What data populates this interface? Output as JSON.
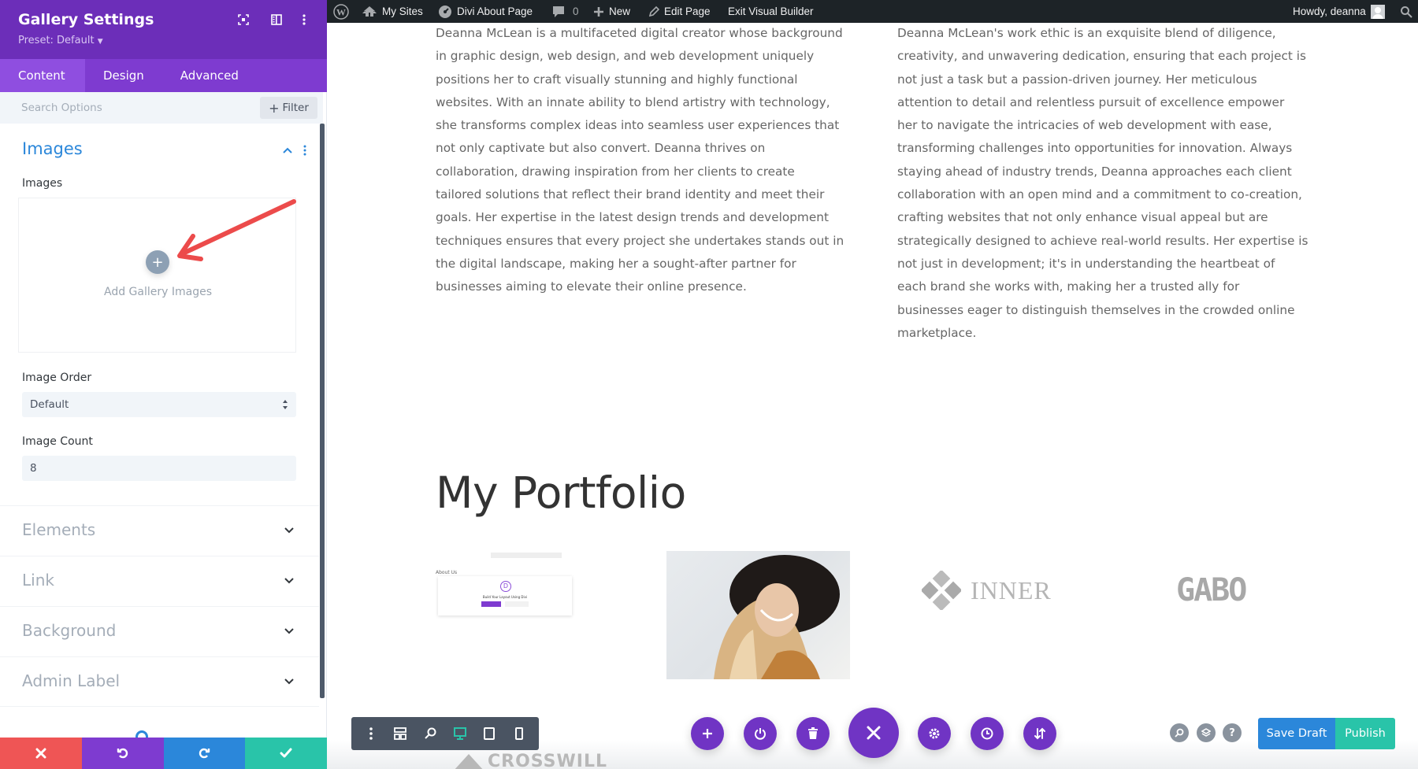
{
  "sidebar": {
    "title": "Gallery Settings",
    "preset": "Preset: Default",
    "tabs": [
      {
        "label": "Content",
        "active": true
      },
      {
        "label": "Design",
        "active": false
      },
      {
        "label": "Advanced",
        "active": false
      }
    ],
    "search_placeholder": "Search Options",
    "filter_label": "Filter",
    "section": {
      "title": "Images",
      "images_label": "Images",
      "add_gallery_label": "Add Gallery Images",
      "image_order_label": "Image Order",
      "image_order_value": "Default",
      "image_count_label": "Image Count",
      "image_count_value": "8"
    },
    "collapsed_sections": [
      "Elements",
      "Link",
      "Background",
      "Admin Label"
    ],
    "footer_colors": {
      "cancel": "#ef5555",
      "undo": "#7e3bd0",
      "redo": "#2b87da",
      "save": "#29c4a9"
    }
  },
  "wpbar": {
    "my_sites": "My Sites",
    "site_name": "Divi About Page",
    "comments_count": "0",
    "new_label": "New",
    "edit_page": "Edit Page",
    "exit_builder": "Exit Visual Builder",
    "howdy": "Howdy, deanna"
  },
  "content": {
    "left_paragraph_lines": [
      "Deanna McLean is a multifaceted digital creator whose background",
      "in graphic design, web design, and web development uniquely",
      "positions her to craft visually stunning and highly functional",
      "websites. With an innate ability to blend artistry with technology,",
      "she transforms complex ideas into seamless user experiences that",
      "not only captivate but also convert. Deanna thrives on",
      "collaboration, drawing inspiration from her clients to create",
      "tailored solutions that reflect their brand identity and meet their",
      "goals. Her expertise in the latest design trends and development",
      "techniques ensures that every project she undertakes stands out in",
      "the digital landscape, making her a sought-after partner for",
      "businesses aiming to elevate their online presence."
    ],
    "right_paragraph_lines": [
      "Deanna McLean's work ethic is an exquisite blend of diligence,",
      "creativity, and unwavering dedication, ensuring that each project is",
      "not just a task but a passion-driven journey. Her meticulous",
      "attention to detail and relentless pursuit of excellence empower",
      "her to navigate the intricacies of web development with ease,",
      "transforming challenges into opportunities for innovation. Always",
      "staying ahead of industry trends, Deanna approaches each client",
      "collaboration with an open mind and a commitment to co-creation,",
      "crafting websites that not only enhance visual appeal but are",
      "strategically designed to achieve real-world results. Her expertise is",
      "not just in development; it's in understanding the heartbeat of",
      "each brand she works with, making her a trusted ally for",
      "businesses eager to distinguish themselves in the crowded online",
      "marketplace."
    ],
    "portfolio_title": "My Portfolio",
    "gallery": [
      {
        "type": "screenshot",
        "caption": "About Us",
        "subtitle": "Build Your Layout Using Divi"
      },
      {
        "type": "photo",
        "alt": "woman in black hat"
      },
      {
        "type": "logo",
        "text": "INNER"
      },
      {
        "type": "logo",
        "text": "GABO"
      }
    ],
    "partial_logo": "CROSSWILL"
  },
  "toolbar": {
    "save_draft": "Save Draft",
    "publish": "Publish",
    "colors": {
      "purple": "#7034c4",
      "blue": "#2b87da",
      "green": "#29c4a9"
    }
  }
}
